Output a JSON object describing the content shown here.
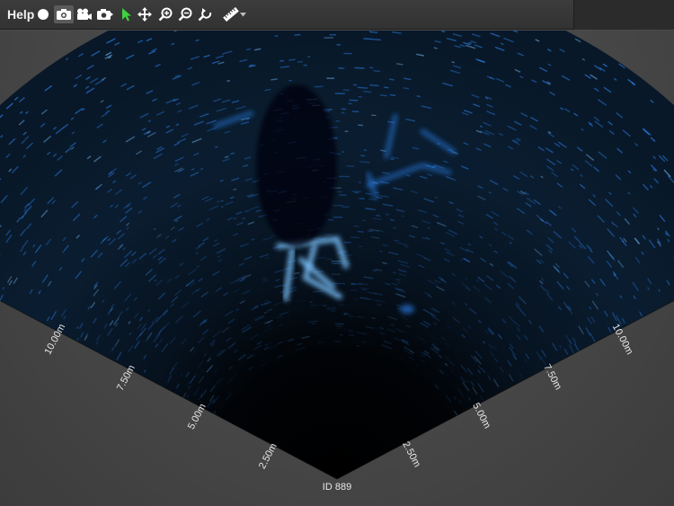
{
  "toolbar": {
    "help_label": "Help",
    "icons": [
      {
        "name": "record-icon"
      },
      {
        "name": "camera-icon"
      },
      {
        "name": "video-camera-icon"
      },
      {
        "name": "snapshot-icon"
      },
      {
        "name": "select-cursor-icon",
        "active": true
      },
      {
        "name": "pan-icon"
      },
      {
        "name": "zoom-in-icon"
      },
      {
        "name": "zoom-out-icon"
      },
      {
        "name": "zoom-reset-icon"
      },
      {
        "name": "measure-ruler-icon"
      }
    ],
    "dropdown_icon": "chevron-down-icon",
    "accent_active": "#3fd23f"
  },
  "sonar": {
    "colors": {
      "echo": "#2f8bff",
      "echo_bright": "#7cc4ff",
      "fan_bg": "#02070d"
    },
    "left_axis_ticks": [
      "2.50m",
      "5.00m",
      "7.50m",
      "10.00m"
    ],
    "right_axis_ticks": [
      "2.50m",
      "5.00m",
      "7.50m",
      "10.00m"
    ],
    "ping_id": "ID 889"
  }
}
